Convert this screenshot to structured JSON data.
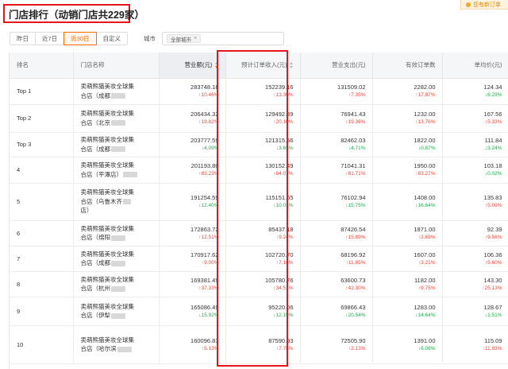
{
  "title": "门店排行（动销门店共229家）",
  "top_notice": "您有新订单",
  "filters": {
    "tabs": [
      {
        "label": "昨日",
        "active": false
      },
      {
        "label": "近7日",
        "active": false
      },
      {
        "label": "近30日",
        "active": true
      },
      {
        "label": "自定义",
        "active": false
      }
    ],
    "city_label": "城市",
    "city_tag": "全部城市",
    "city_tag_close": "×"
  },
  "table": {
    "columns": [
      {
        "label": "排名",
        "sort": false
      },
      {
        "label": "门店名称",
        "sort": false
      },
      {
        "label": "营业额(元)",
        "sort": true
      },
      {
        "label": "预计订单收入(元)",
        "sort": true
      },
      {
        "label": "营业支出(元)",
        "sort": false
      },
      {
        "label": "有效订单数",
        "sort": false
      },
      {
        "label": "单均价(元)",
        "sort": false
      }
    ],
    "rows": [
      {
        "rank": "Top 1",
        "store": [
          "卖萌熊猫美妆全球集",
          "合店（成都"
        ],
        "revenue": "283748.18",
        "revenue_chg": "↑10.46%",
        "revenue_dir": "up",
        "income": "152239.16",
        "income_chg": "↑13.30%",
        "income_dir": "up",
        "expense": "131509.02",
        "expense_chg": "↑7.35%",
        "expense_dir": "up",
        "orders": "2282.00",
        "orders_chg": "↑17.87%",
        "orders_dir": "up",
        "avg": "124.34",
        "avg_chg": "↓6.29%",
        "avg_dir": "down"
      },
      {
        "rank": "Top 2",
        "store": [
          "卖萌熊猫美妆全球集",
          "合店（北京"
        ],
        "revenue": "206434.32",
        "revenue_chg": "↑19.82%",
        "revenue_dir": "up",
        "income": "129492.89",
        "income_chg": "↑20.10%",
        "income_dir": "up",
        "expense": "76941.43",
        "expense_chg": "↑19.36%",
        "expense_dir": "up",
        "orders": "1232.00",
        "orders_chg": "↑13.76%",
        "orders_dir": "up",
        "avg": "167.56",
        "avg_chg": "↑5.33%",
        "avg_dir": "up"
      },
      {
        "rank": "Top 3",
        "store": [
          "卖萌熊猫美妆全球集",
          "合店（成都"
        ],
        "revenue": "203777.59",
        "revenue_chg": "↓4.09%",
        "revenue_dir": "down",
        "income": "121315.56",
        "income_chg": "↓3.65%",
        "income_dir": "down",
        "expense": "82462.03",
        "expense_chg": "↓4.71%",
        "expense_dir": "down",
        "orders": "1822.00",
        "orders_chg": "↓0.87%",
        "orders_dir": "down",
        "avg": "111.84",
        "avg_chg": "↓3.24%",
        "avg_dir": "down"
      },
      {
        "rank": "4",
        "store": [
          "卖萌熊猫美妆全球集",
          "合店（平潭店）"
        ],
        "revenue": "201193.80",
        "revenue_chg": "↑83.23%",
        "revenue_dir": "up",
        "income": "130152.49",
        "income_chg": "↑84.07%",
        "income_dir": "up",
        "expense": "71041.31",
        "expense_chg": "↑81.71%",
        "expense_dir": "up",
        "orders": "1950.00",
        "orders_chg": "↑83.27%",
        "orders_dir": "up",
        "avg": "103.18",
        "avg_chg": "↓0.02%",
        "avg_dir": "down"
      },
      {
        "rank": "5",
        "store": [
          "卖萌熊猫美妆全球集",
          "合店（乌鲁木齐",
          "店）"
        ],
        "revenue": "191254.59",
        "revenue_chg": "↓12.40%",
        "revenue_dir": "down",
        "income": "115151.65",
        "income_chg": "↓10.03%",
        "income_dir": "down",
        "expense": "76102.94",
        "expense_chg": "↓15.75%",
        "expense_dir": "down",
        "orders": "1408.00",
        "orders_chg": "↓16.64%",
        "orders_dir": "down",
        "avg": "135.83",
        "avg_chg": "↑5.09%",
        "avg_dir": "up"
      },
      {
        "rank": "6",
        "store": [
          "卖萌熊猫美妆全球集",
          "合店（绵阳"
        ],
        "revenue": "172863.72",
        "revenue_chg": "↑12.51%",
        "revenue_dir": "up",
        "income": "85437.18",
        "income_chg": "↑9.24%",
        "income_dir": "up",
        "expense": "87426.54",
        "expense_chg": "↑15.89%",
        "expense_dir": "up",
        "orders": "1871.00",
        "orders_chg": "↑2.69%",
        "orders_dir": "up",
        "avg": "92.39",
        "avg_chg": "↑9.56%",
        "avg_dir": "up"
      },
      {
        "rank": "7",
        "store": [
          "卖萌熊猫美妆全球集",
          "合店（成都"
        ],
        "revenue": "170917.62",
        "revenue_chg": "↑9.00%",
        "revenue_dir": "up",
        "income": "102720.70",
        "income_chg": "↑7.18%",
        "income_dir": "up",
        "expense": "68196.92",
        "expense_chg": "↑11.85%",
        "expense_dir": "up",
        "orders": "1607.00",
        "orders_chg": "↑3.21%",
        "orders_dir": "up",
        "avg": "106.36",
        "avg_chg": "↑5.60%",
        "avg_dir": "up"
      },
      {
        "rank": "8",
        "store": [
          "卖萌熊猫美妆全球集",
          "合店（杭州"
        ],
        "revenue": "169381.49",
        "revenue_chg": "↑37.33%",
        "revenue_dir": "up",
        "income": "105780.76",
        "income_chg": "↑34.51%",
        "income_dir": "up",
        "expense": "63600.73",
        "expense_chg": "↑42.30%",
        "expense_dir": "up",
        "orders": "1182.00",
        "orders_chg": "↑9.75%",
        "orders_dir": "up",
        "avg": "143.30",
        "avg_chg": "↑25.13%",
        "avg_dir": "up"
      },
      {
        "rank": "9",
        "store": [
          "卖萌熊猫美妆全球集",
          "合店（伊犁"
        ],
        "revenue": "165086.49",
        "revenue_chg": "↓15.92%",
        "revenue_dir": "down",
        "income": "95220.06",
        "income_chg": "↓12.19%",
        "income_dir": "down",
        "expense": "69866.43",
        "expense_chg": "↓20.54%",
        "expense_dir": "down",
        "orders": "1283.00",
        "orders_chg": "↓14.64%",
        "orders_dir": "down",
        "avg": "128.67",
        "avg_chg": "↓1.51%",
        "avg_dir": "down"
      },
      {
        "rank": "10",
        "store": [
          "卖萌熊猫美妆全球集",
          "合店（哈尔滨"
        ],
        "revenue": "160096.83",
        "revenue_chg": "↑5.13%",
        "revenue_dir": "up",
        "income": "87590.93",
        "income_chg": "↑7.75%",
        "income_dir": "up",
        "expense": "72505.90",
        "expense_chg": "↑2.13%",
        "expense_dir": "up",
        "orders": "1391.00",
        "orders_chg": "↓6.08%",
        "orders_dir": "down",
        "avg": "115.09",
        "avg_chg": "↑11.93%",
        "avg_dir": "up"
      }
    ]
  },
  "colors": {
    "accent": "#ff6a00",
    "highlight_border": "#e8141b",
    "increase": "#f04134",
    "decrease": "#1aad4b"
  }
}
